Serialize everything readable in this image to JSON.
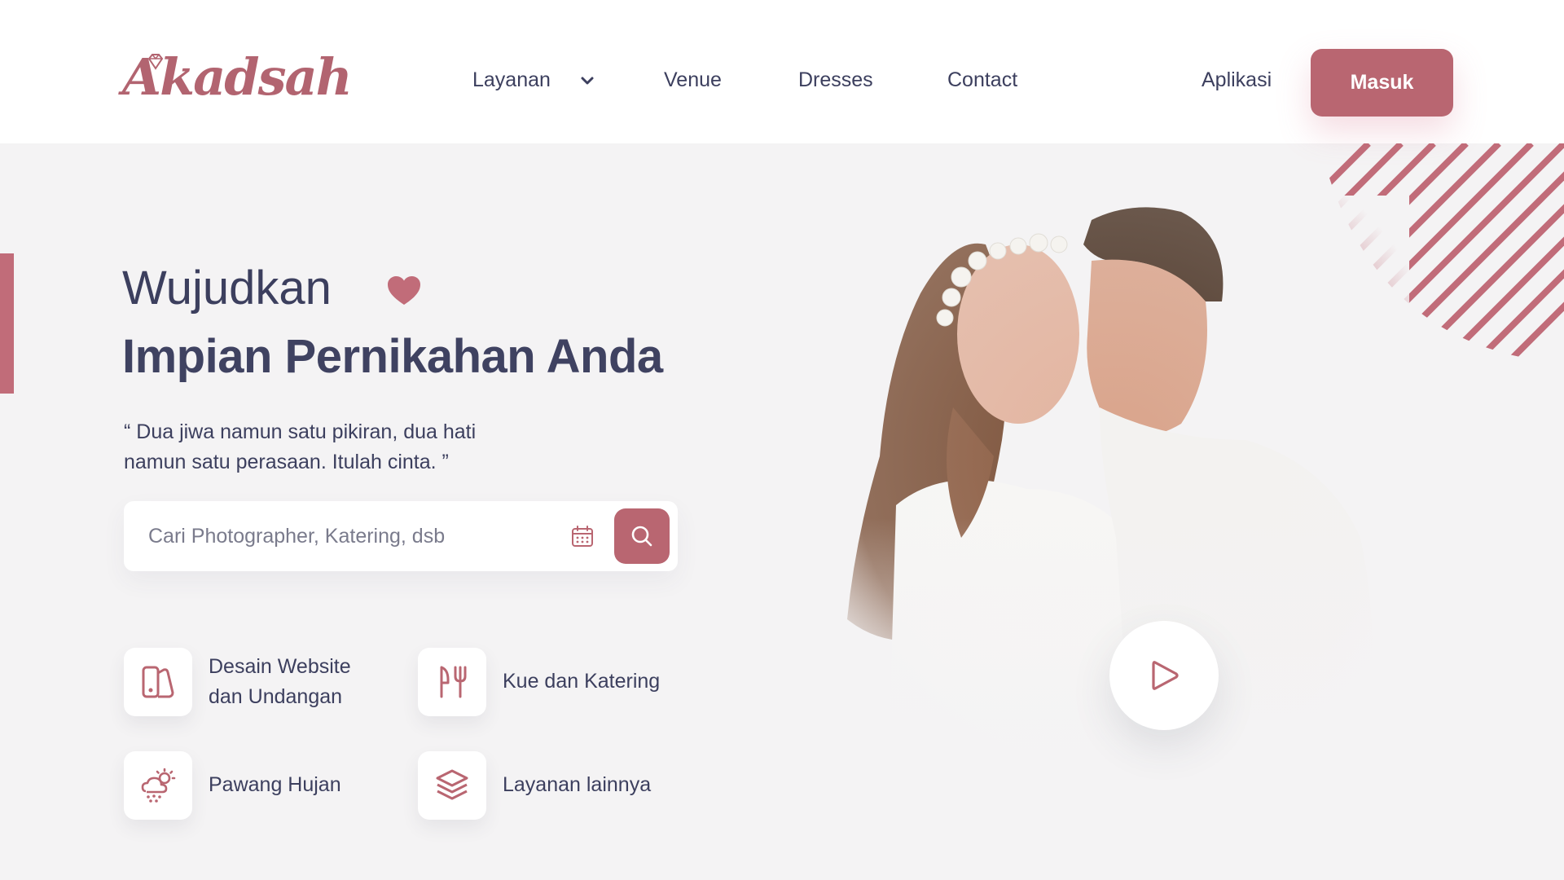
{
  "brand": {
    "logo_text": "Akadsah",
    "accent_color": "#b96671",
    "text_color": "#3c3f5e"
  },
  "nav": {
    "items": [
      {
        "label": "Layanan",
        "has_dropdown": true
      },
      {
        "label": "Venue"
      },
      {
        "label": "Dresses"
      },
      {
        "label": "Contact"
      }
    ],
    "app_link": "Aplikasi",
    "login_button": "Masuk"
  },
  "hero": {
    "title_line1": "Wujudkan",
    "title_line2": "Impian Pernikahan Anda",
    "quote_line1": "“ Dua jiwa namun satu pikiran, dua hati",
    "quote_line2": "namun satu perasaan. Itulah cinta. ”"
  },
  "search": {
    "placeholder": "Cari Photographer, Katering, dsb",
    "value": "",
    "calendar_icon": "calendar-icon",
    "button_icon": "search-icon"
  },
  "services": [
    {
      "line1": "Desain Website",
      "line2": "dan Undangan",
      "icon": "website-design-icon"
    },
    {
      "line1": "Kue dan Katering",
      "line2": "",
      "icon": "fork-knife-icon"
    },
    {
      "line1": "Pawang Hujan",
      "line2": "",
      "icon": "weather-icon"
    },
    {
      "line1": "Layanan lainnya",
      "line2": "",
      "icon": "layers-icon"
    }
  ],
  "media": {
    "play_icon": "play-icon"
  }
}
